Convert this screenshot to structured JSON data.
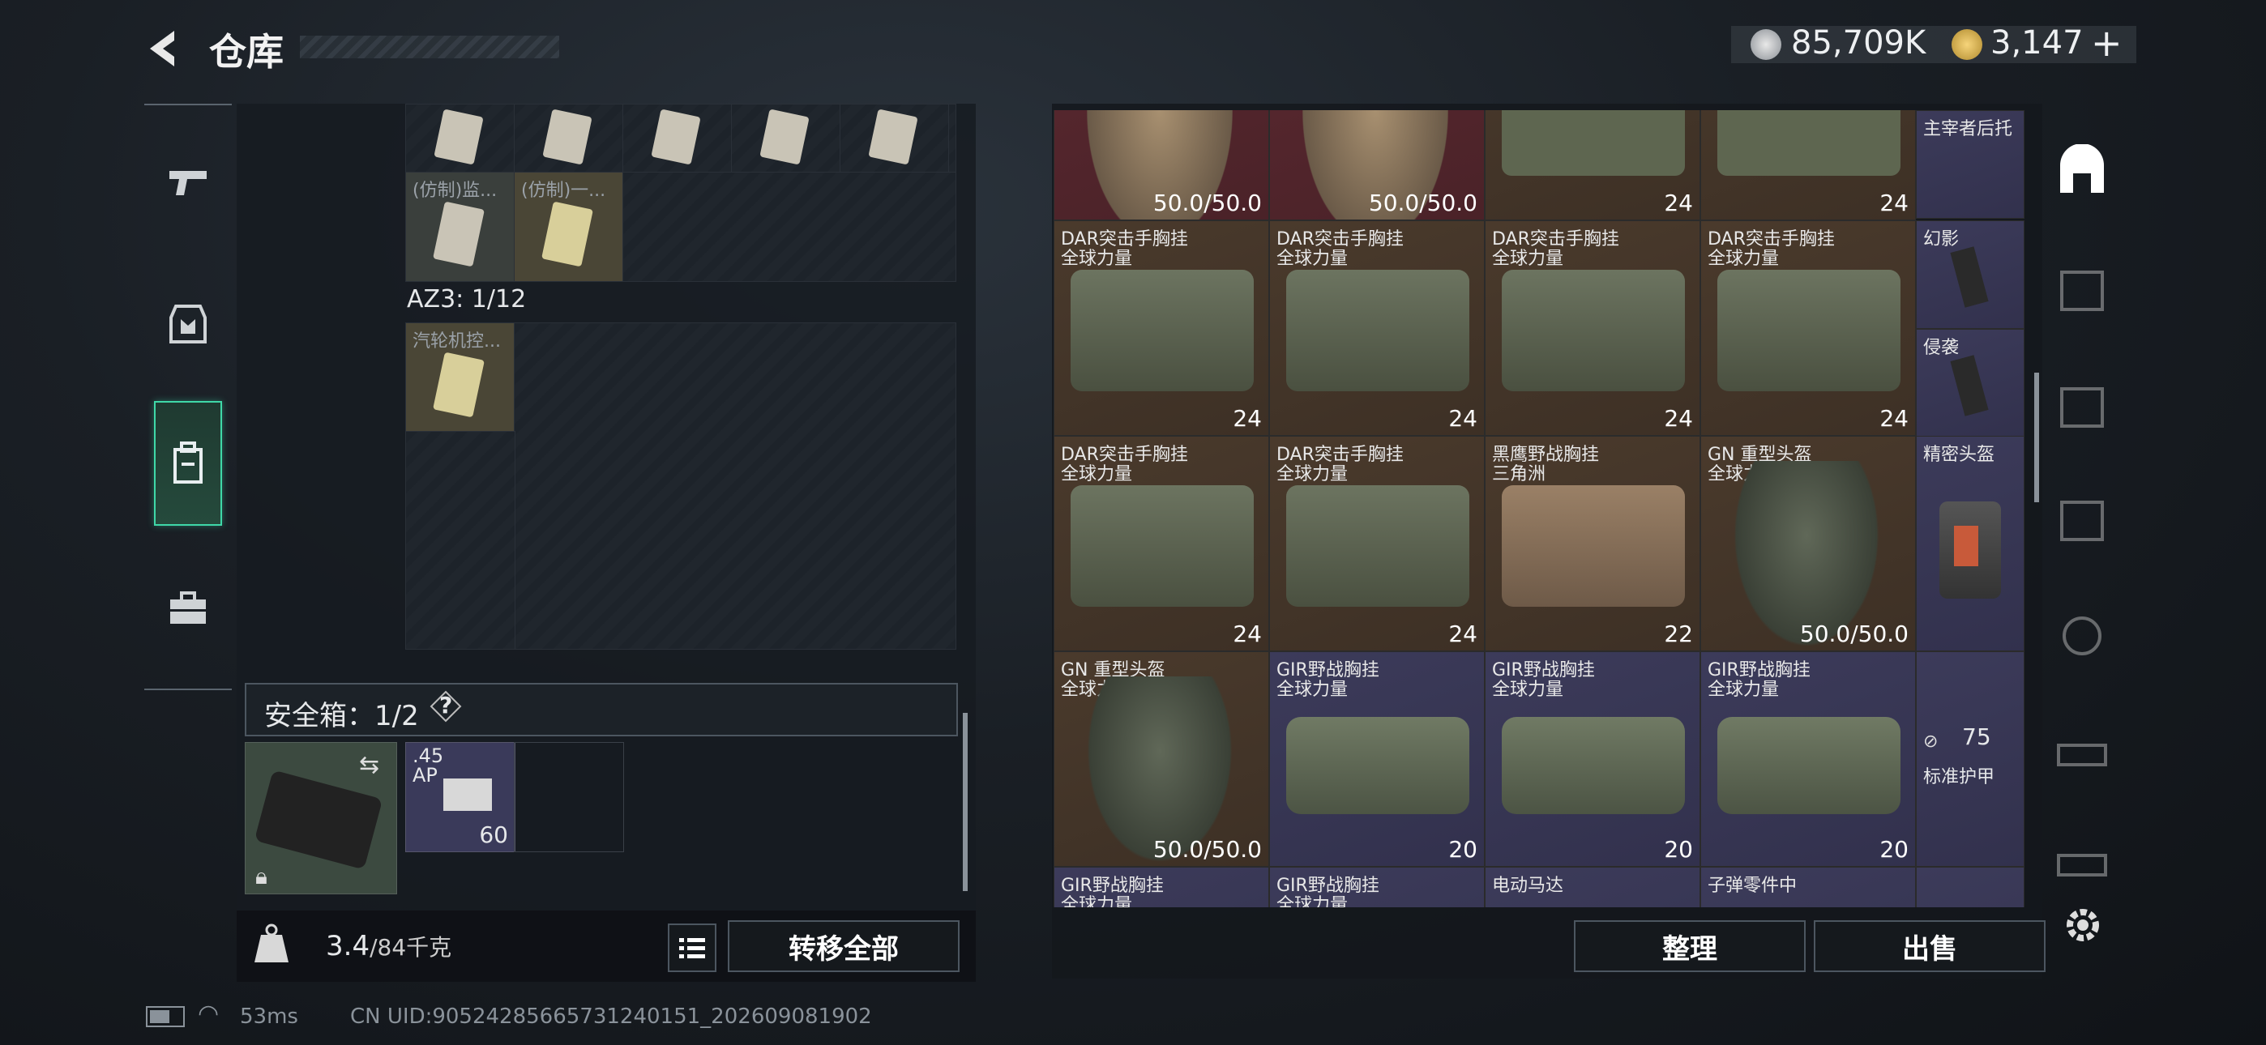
{
  "header": {
    "title": "仓库",
    "currency1": "85,709K",
    "currency2": "3,147",
    "plus": "+"
  },
  "left": {
    "slot_labels": [
      "(仿制)监...",
      "(仿制)一..."
    ],
    "az3_label": "AZ3: 1/12",
    "az3_item": "汽轮机控...",
    "safe_box": "安全箱：1/2",
    "help": "?",
    "ammo_name": ".45 AP",
    "ammo_count": "60",
    "weight_value": "3.4",
    "weight_max": "/84千克",
    "transfer_all": "转移全部"
  },
  "right": {
    "row0": [
      {
        "dur": "50.0/50.0"
      },
      {
        "dur": "50.0/50.0"
      },
      {
        "val": "24"
      },
      {
        "val": "24"
      }
    ],
    "row0_side": "主宰者后托",
    "row1": [
      {
        "n1": "DAR突击手胸挂",
        "n2": "全球力量",
        "val": "24"
      },
      {
        "n1": "DAR突击手胸挂",
        "n2": "全球力量",
        "val": "24"
      },
      {
        "n1": "DAR突击手胸挂",
        "n2": "全球力量",
        "val": "24"
      },
      {
        "n1": "DAR突击手胸挂",
        "n2": "全球力量",
        "val": "24"
      }
    ],
    "row1_side": [
      "幻影",
      "侵袭"
    ],
    "row2": [
      {
        "n1": "DAR突击手胸挂",
        "n2": "全球力量",
        "val": "24"
      },
      {
        "n1": "DAR突击手胸挂",
        "n2": "全球力量",
        "val": "24"
      },
      {
        "n1": "黑鹰野战胸挂",
        "n2": "三角洲",
        "val": "22"
      },
      {
        "n1": "GN 重型头盔",
        "n2": "全球力量",
        "dur": "50.0/50.0"
      }
    ],
    "row2_side": "精密头盔",
    "row3": [
      {
        "n1": "GN 重型头盔",
        "n2": "全球力量",
        "dur": "50.0/50.0"
      },
      {
        "n1": "GIR野战胸挂",
        "n2": "全球力量",
        "val": "20"
      },
      {
        "n1": "GIR野战胸挂",
        "n2": "全球力量",
        "val": "20"
      },
      {
        "n1": "GIR野战胸挂",
        "n2": "全球力量",
        "val": "20"
      }
    ],
    "row3_side": {
      "val": "75",
      "name": "标准护甲"
    },
    "row4": [
      {
        "n1": "GIR野战胸挂",
        "n2": "全球力量"
      },
      {
        "n1": "GIR野战胸挂",
        "n2": "全球力量"
      },
      {
        "n1": "电动马达"
      },
      {
        "n1": "子弹零件中"
      }
    ],
    "tidy": "整理",
    "sell": "出售"
  },
  "status": {
    "ping": "53ms",
    "uid": "CN UID:90524285665731240151_202609081902"
  },
  "colors": {
    "accent": "#3fd8a8",
    "brown": "#4a3a2c",
    "red": "#5a2830",
    "purple": "#3c3b5a"
  }
}
